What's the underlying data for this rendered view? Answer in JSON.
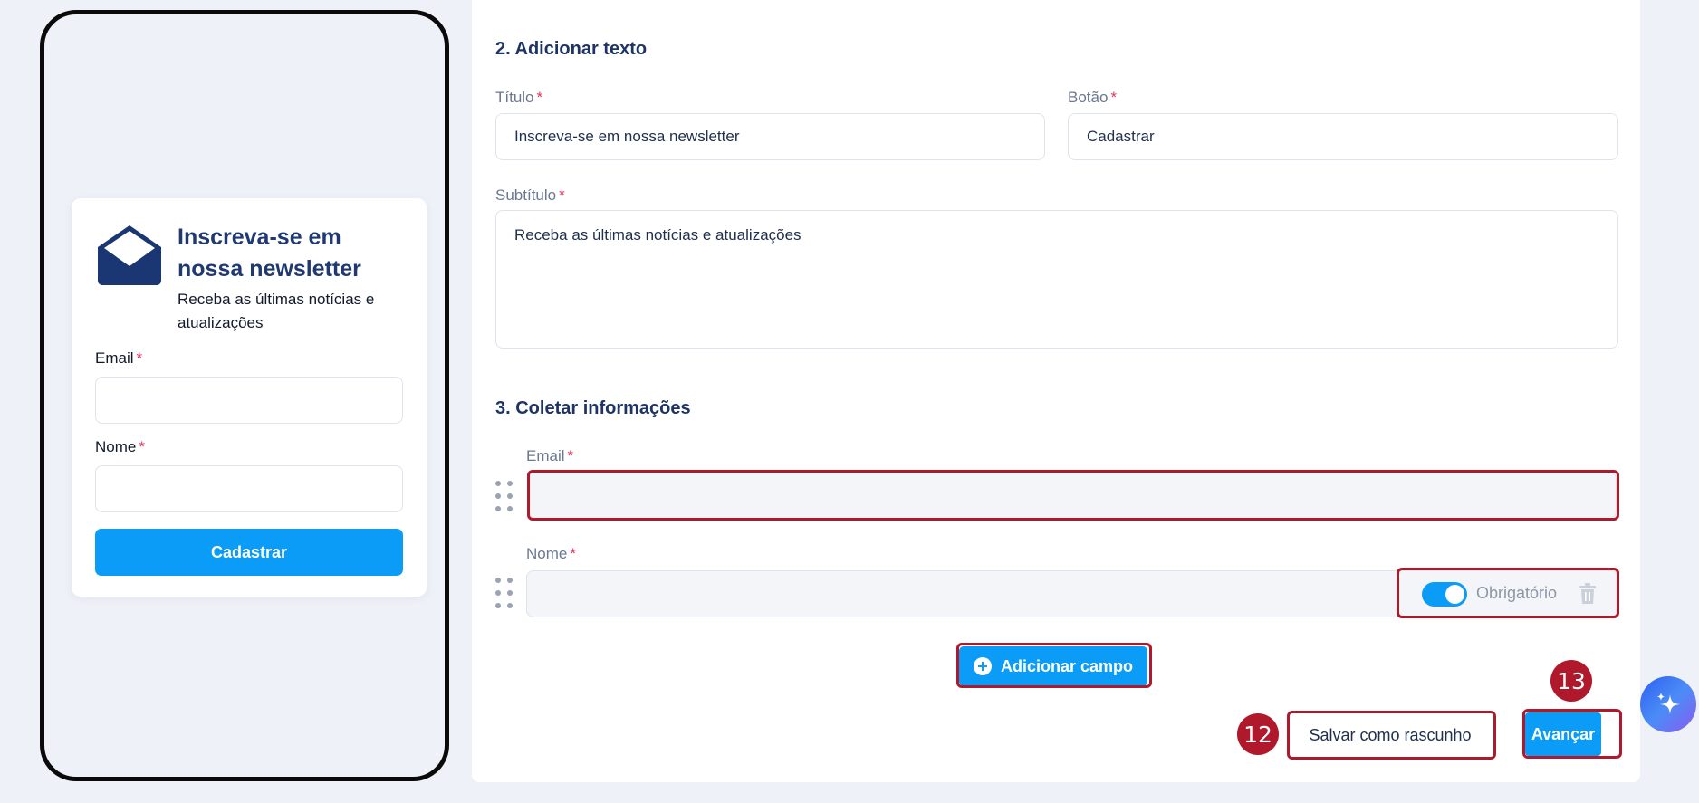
{
  "preview": {
    "title": "Inscreva-se em nossa newsletter",
    "subtitle": "Receba as últimas notícias e atualizações",
    "fields": [
      {
        "label": "Email",
        "required_mark": "*"
      },
      {
        "label": "Nome",
        "required_mark": "*"
      }
    ],
    "button_label": "Cadastrar",
    "icon": "envelope-open-icon"
  },
  "section_text": {
    "heading": "2. Adicionar texto",
    "title_label": "Título",
    "title_value": "Inscreva-se em nossa newsletter",
    "button_label": "Botão",
    "button_value": "Cadastrar",
    "subtitle_label": "Subtítulo",
    "subtitle_value": "Receba as últimas notícias e atualizações",
    "required_mark": "*"
  },
  "section_collect": {
    "heading": "3. Coletar informações",
    "fields": [
      {
        "label": "Email",
        "required_mark": "*"
      },
      {
        "label": "Nome",
        "required_mark": "*",
        "required_toggle_label": "Obrigatório",
        "required_on": true
      }
    ],
    "add_field_label": "Adicionar campo"
  },
  "actions": {
    "save_draft_label": "Salvar como rascunho",
    "next_label": "Avançar"
  },
  "annotations": {
    "badge_save": "12",
    "badge_next": "13"
  },
  "colors": {
    "accent": "#0a9cf7",
    "highlight": "#b0182b",
    "heading": "#1e3464",
    "required": "#e8315b"
  }
}
